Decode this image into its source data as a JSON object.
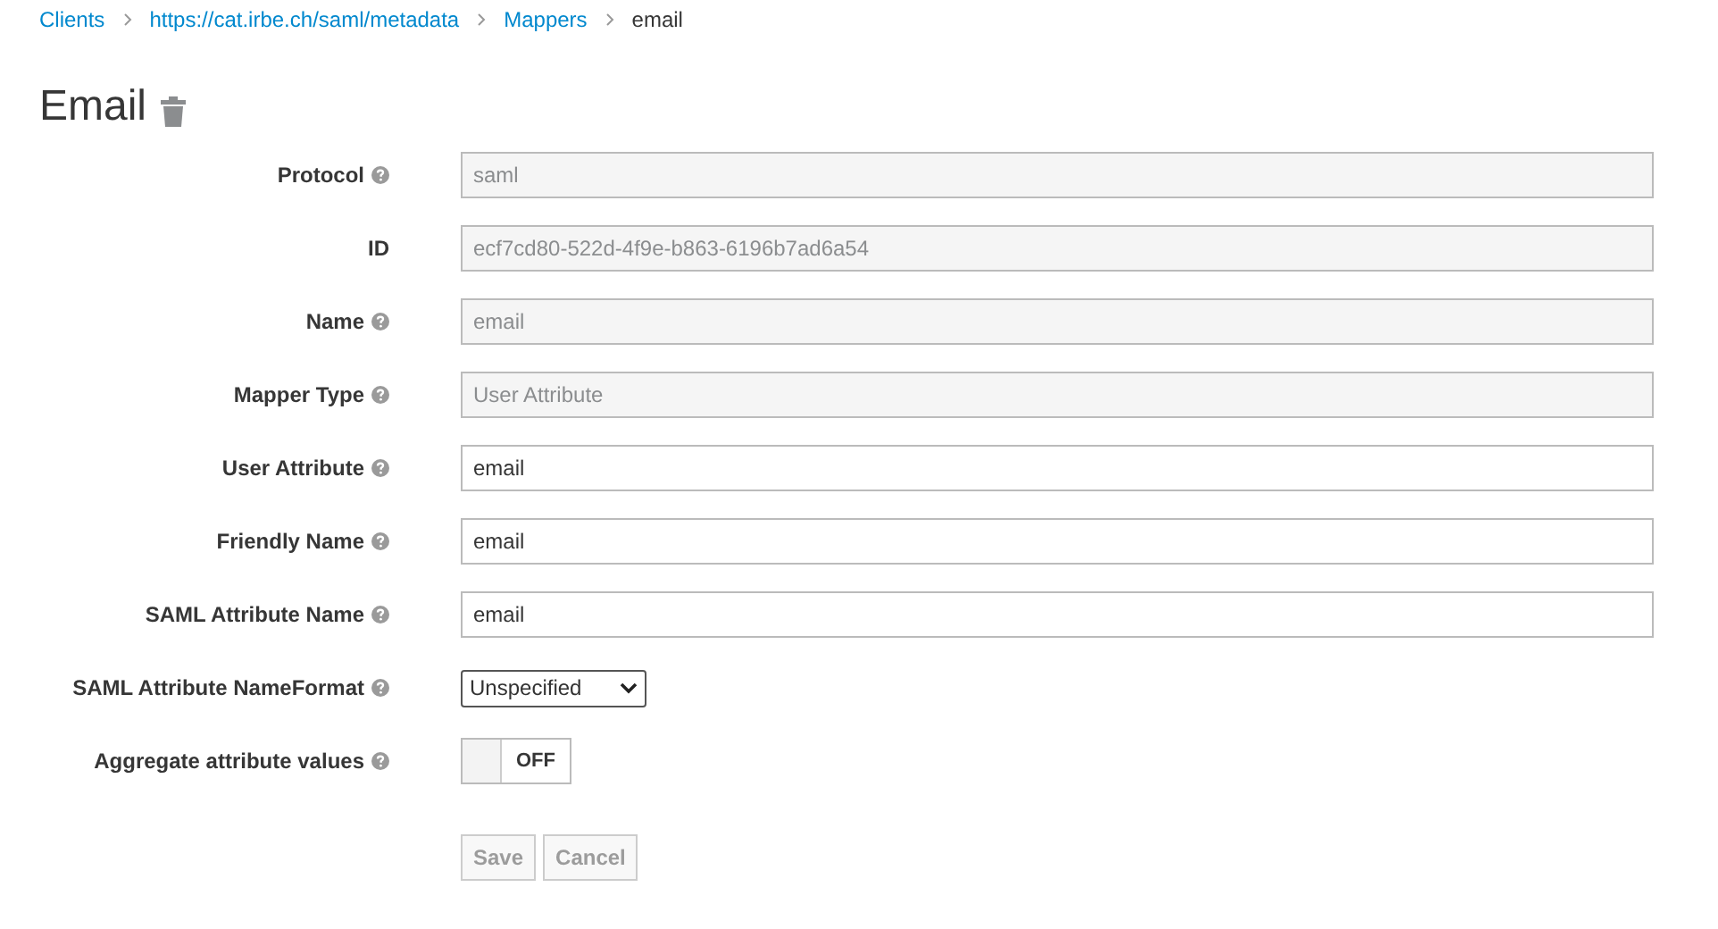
{
  "breadcrumb": [
    {
      "label": "Clients",
      "link": true
    },
    {
      "label": "https://cat.irbe.ch/saml/metadata",
      "link": true
    },
    {
      "label": "Mappers",
      "link": true
    },
    {
      "label": "email",
      "link": false
    }
  ],
  "title": "Email",
  "fields": [
    {
      "kind": "text",
      "label": "Protocol",
      "help": true,
      "value": "saml",
      "disabled": true
    },
    {
      "kind": "text",
      "label": "ID",
      "help": false,
      "value": "ecf7cd80-522d-4f9e-b863-6196b7ad6a54",
      "disabled": true
    },
    {
      "kind": "text",
      "label": "Name",
      "help": true,
      "value": "email",
      "disabled": true
    },
    {
      "kind": "text",
      "label": "Mapper Type",
      "help": true,
      "value": "User Attribute",
      "disabled": true
    },
    {
      "kind": "text",
      "label": "User Attribute",
      "help": true,
      "value": "email",
      "disabled": false
    },
    {
      "kind": "text",
      "label": "Friendly Name",
      "help": true,
      "value": "email",
      "disabled": false
    },
    {
      "kind": "text",
      "label": "SAML Attribute Name",
      "help": true,
      "value": "email",
      "disabled": false
    },
    {
      "kind": "select",
      "label": "SAML Attribute NameFormat",
      "help": true,
      "value": "Unspecified"
    },
    {
      "kind": "switch",
      "label": "Aggregate attribute values",
      "help": true,
      "on": false,
      "value": "OFF"
    }
  ],
  "buttons": [
    {
      "label": "Save",
      "disabled": true
    },
    {
      "label": "Cancel",
      "disabled": true
    }
  ]
}
